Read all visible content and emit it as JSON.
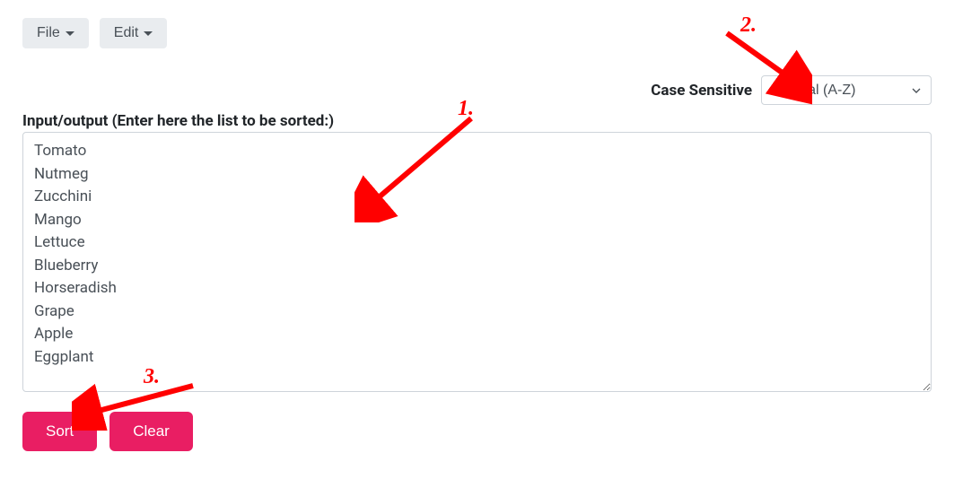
{
  "toolbar": {
    "file_label": "File",
    "edit_label": "Edit"
  },
  "options": {
    "case_label": "Case Sensitive",
    "selected": "Natural (A-Z)"
  },
  "input": {
    "label": "Input/output (Enter here the list to be sorted:)",
    "value": "Tomato\nNutmeg\nZucchini\nMango\nLettuce\nBlueberry\nHorseradish\nGrape\nApple\nEggplant"
  },
  "actions": {
    "sort_label": "Sort",
    "clear_label": "Clear"
  },
  "annotations": {
    "one": "1.",
    "two": "2.",
    "three": "3."
  }
}
